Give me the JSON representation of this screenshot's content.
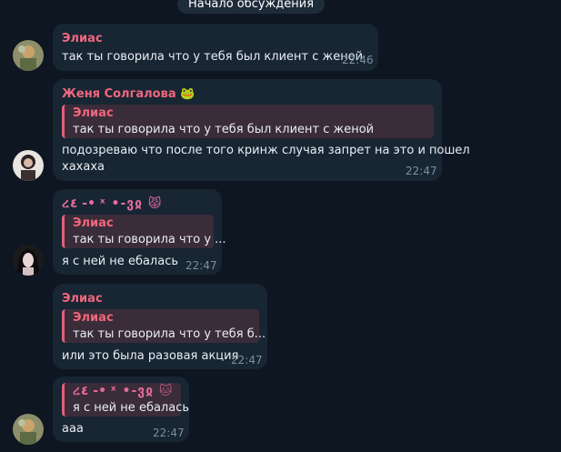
{
  "header": {
    "pill": "Начало обсуждения"
  },
  "messages": [
    {
      "author": "Элиас",
      "author_color": "#f0677d",
      "text": "так ты говорила что у тебя  был клиент с женой",
      "time": "22:46",
      "avatar": "avatar-elias"
    },
    {
      "author": "Женя Солгалова",
      "author_color": "#f0677d",
      "author_emoji": "🐸",
      "reply_author": "Элиас",
      "reply_text": "так ты говорила что у тебя  был клиент с женой",
      "text_line1": "подозреваю что после того кринж случая запрет на это и пошел",
      "text_line2": "хахаха",
      "time": "22:47"
    },
    {
      "author": "ረ٤ -• ˣ •-ვჲ",
      "author_emoji": "😾",
      "reply_author": "Элиас",
      "reply_text": "так ты говорила что у ...",
      "text": "я с ней не ебалась",
      "time": "22:47"
    },
    {
      "author": "Элиас",
      "author_color": "#f0677d",
      "reply_author": "Элиас",
      "reply_text": "так ты говорила что у тебя  б...",
      "text": "или это была разовая акция",
      "time": "22:47"
    },
    {
      "reply_author": "ረ٤ -• ˣ •-ვჲ",
      "reply_emoji": "🐱",
      "reply_text": "я с ней не ебалась",
      "text": "ааа",
      "time": "22:47"
    }
  ]
}
